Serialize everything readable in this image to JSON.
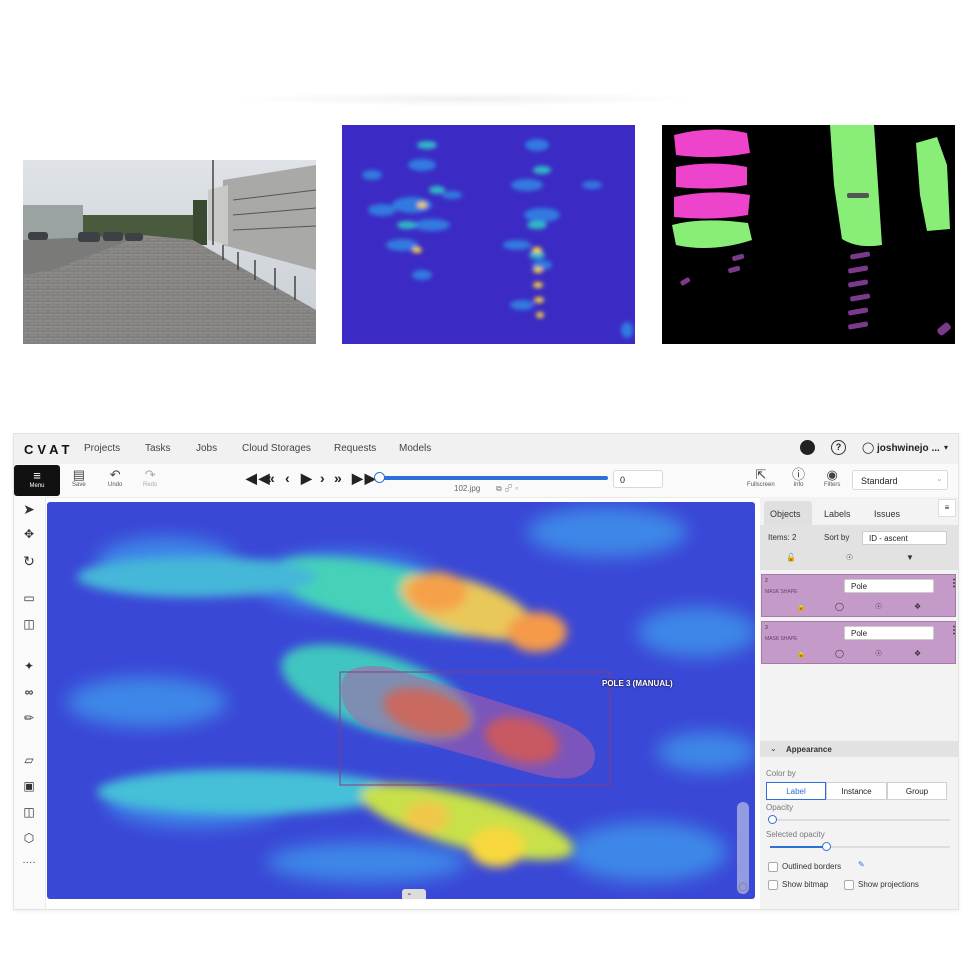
{
  "app": {
    "logo": "CVAT",
    "nav": [
      "Projects",
      "Tasks",
      "Jobs",
      "Cloud Storages",
      "Requests",
      "Models"
    ],
    "help_icon": "question-circle-icon",
    "user": "joshwinejo ...",
    "github_icon": "github-icon"
  },
  "toolbar": {
    "menu_label": "Menu",
    "save_label": "Save",
    "undo_label": "Undo",
    "redo_label": "Redo",
    "frame_value": "0",
    "filename": "102.jpg",
    "fullscreen_label": "Fullscreen",
    "info_label": "Info",
    "filters_label": "Filters",
    "workspace": "Standard"
  },
  "canvas": {
    "annotation_label": "POLE 3 (MANUAL)"
  },
  "panel": {
    "tabs": [
      "Objects",
      "Labels",
      "Issues"
    ],
    "items_count": "Items: 2",
    "sort_label": "Sort by",
    "sort_value": "ID - ascent",
    "objects": [
      {
        "id": "2",
        "type": "MASK SHAPE",
        "label": "Pole"
      },
      {
        "id": "3",
        "type": "MASK SHAPE",
        "label": "Pole"
      }
    ],
    "appearance": {
      "title": "Appearance",
      "color_by": "Color by",
      "options": [
        "Label",
        "Instance",
        "Group"
      ],
      "selected_option": "Label",
      "opacity": "Opacity",
      "selected_opacity": "Selected opacity",
      "opacity_level": 0.05,
      "selected_opacity_level": 0.4,
      "outlined_borders": "Outlined borders",
      "show_bitmap": "Show bitmap",
      "show_projections": "Show projections"
    }
  },
  "colors": {
    "accent": "#2e6fd8",
    "mask_card": "#c49ac9",
    "mask_magenta": "#ee44cc",
    "mask_green": "#88ee77"
  }
}
